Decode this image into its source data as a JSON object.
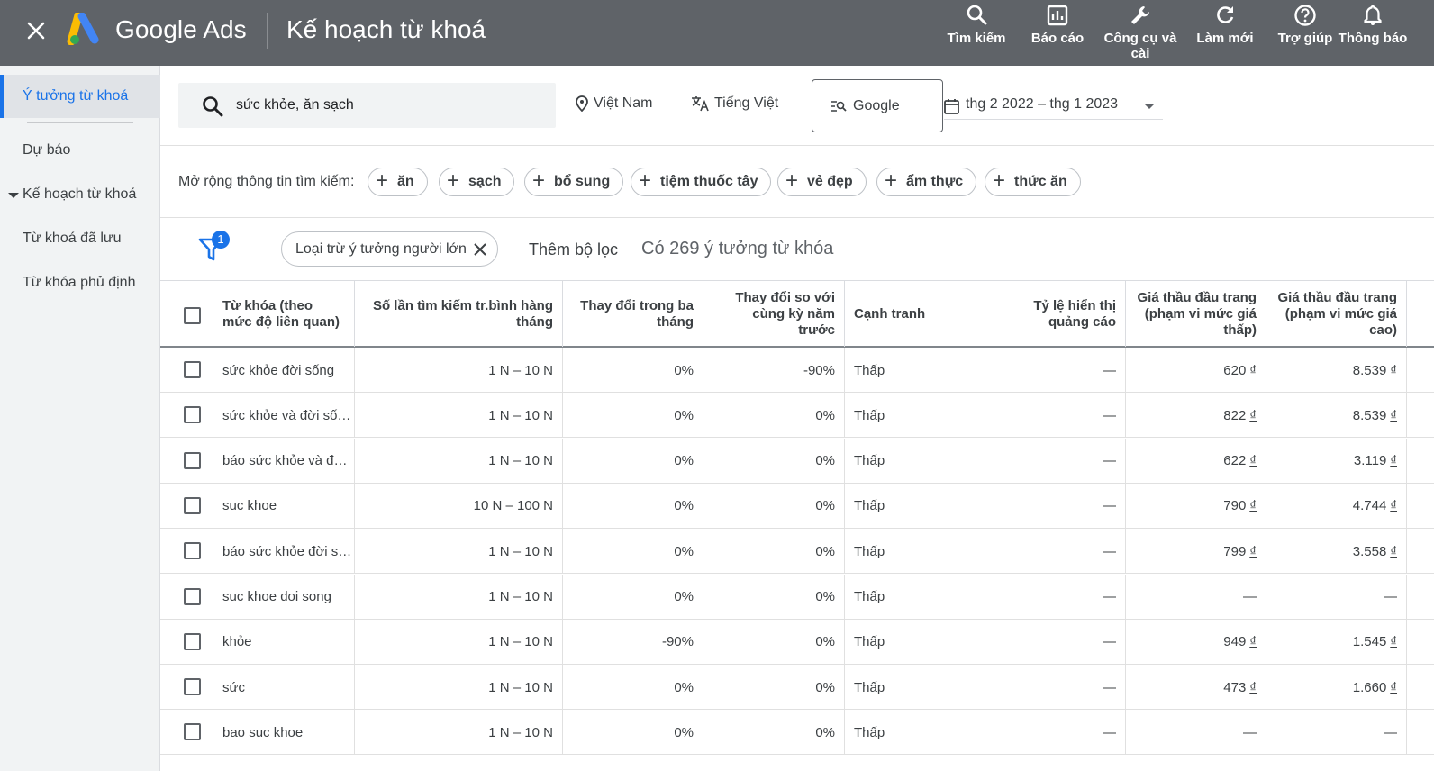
{
  "header": {
    "brand": "Google Ads",
    "page_title": "Kế hoạch từ khoá",
    "actions": [
      {
        "label": "Tìm kiếm",
        "icon": "search-icon"
      },
      {
        "label": "Báo cáo",
        "icon": "reports-icon"
      },
      {
        "label": "Công cụ và cài",
        "icon": "wrench-icon"
      },
      {
        "label": "Làm mới",
        "icon": "refresh-icon"
      },
      {
        "label": "Trợ giúp",
        "icon": "help-icon"
      },
      {
        "label": "Thông báo",
        "icon": "bell-icon"
      }
    ]
  },
  "sidebar": {
    "items": [
      {
        "label": "Ý tưởng từ khoá"
      },
      {
        "label": "Dự báo"
      },
      {
        "label": "Kế hoạch từ khoá"
      },
      {
        "label": "Từ khoá đã lưu"
      },
      {
        "label": "Từ khóa phủ định"
      }
    ]
  },
  "search": {
    "value": "sức khỏe, ăn sạch",
    "location": "Việt Nam",
    "language": "Tiếng Việt",
    "network": "Google",
    "date_range": "thg 2 2022 – thg 1 2023"
  },
  "broaden": {
    "label": "Mở rộng thông tin tìm kiếm:",
    "chips": [
      "ăn",
      "sạch",
      "bổ sung",
      "tiệm thuốc tây",
      "vẻ đẹp",
      "ẩm thực",
      "thức ăn"
    ]
  },
  "filters": {
    "badge_count": "1",
    "active_filter": "Loại trừ ý tưởng người lớn",
    "add_filter": "Thêm bộ lọc",
    "idea_count": "Có 269 ý tưởng từ khóa"
  },
  "table": {
    "columns": [
      "Từ khóa (theo mức độ liên quan)",
      "Số lần tìm kiếm tr.bình hàng tháng",
      "Thay đổi trong ba tháng",
      "Thay đổi so với cùng kỳ năm trước",
      "Cạnh tranh",
      "Tỷ lệ hiển thị quảng cáo",
      "Giá thầu đầu trang (phạm vi mức giá thấp)",
      "Giá thầu đầu trang (phạm vi mức giá cao)"
    ],
    "rows": [
      {
        "keyword": "sức khỏe đời sống",
        "volume": "1 N – 10 N",
        "three_month": "0%",
        "yoy": "-90%",
        "competition": "Thấp",
        "impr_share": "—",
        "bid_low_num": "620",
        "bid_high_num": "8.539",
        "currency": "₫"
      },
      {
        "keyword": "sức khỏe và đời số…",
        "volume": "1 N – 10 N",
        "three_month": "0%",
        "yoy": "0%",
        "competition": "Thấp",
        "impr_share": "—",
        "bid_low_num": "822",
        "bid_high_num": "8.539",
        "currency": "₫"
      },
      {
        "keyword": "báo sức khỏe và đ…",
        "volume": "1 N – 10 N",
        "three_month": "0%",
        "yoy": "0%",
        "competition": "Thấp",
        "impr_share": "—",
        "bid_low_num": "622",
        "bid_high_num": "3.119",
        "currency": "₫"
      },
      {
        "keyword": "suc khoe",
        "volume": "10 N – 100 N",
        "three_month": "0%",
        "yoy": "0%",
        "competition": "Thấp",
        "impr_share": "—",
        "bid_low_num": "790",
        "bid_high_num": "4.744",
        "currency": "₫"
      },
      {
        "keyword": "báo sức khỏe đời s…",
        "volume": "1 N – 10 N",
        "three_month": "0%",
        "yoy": "0%",
        "competition": "Thấp",
        "impr_share": "—",
        "bid_low_num": "799",
        "bid_high_num": "3.558",
        "currency": "₫"
      },
      {
        "keyword": "suc khoe doi song",
        "volume": "1 N – 10 N",
        "three_month": "0%",
        "yoy": "0%",
        "competition": "Thấp",
        "impr_share": "—",
        "bid_low_num": "—",
        "bid_high_num": "—",
        "currency": ""
      },
      {
        "keyword": "khỏe",
        "volume": "1 N – 10 N",
        "three_month": "-90%",
        "yoy": "0%",
        "competition": "Thấp",
        "impr_share": "—",
        "bid_low_num": "949",
        "bid_high_num": "1.545",
        "currency": "₫"
      },
      {
        "keyword": "sức",
        "volume": "1 N – 10 N",
        "three_month": "0%",
        "yoy": "0%",
        "competition": "Thấp",
        "impr_share": "—",
        "bid_low_num": "473",
        "bid_high_num": "1.660",
        "currency": "₫"
      },
      {
        "keyword": "bao suc khoe",
        "volume": "1 N – 10 N",
        "three_month": "0%",
        "yoy": "0%",
        "competition": "Thấp",
        "impr_share": "—",
        "bid_low_num": "—",
        "bid_high_num": "—",
        "currency": ""
      }
    ]
  },
  "colors": {
    "topbar": "#5f6368",
    "accent": "#1a73e8",
    "sidebar_bg": "#f1f3f4"
  }
}
